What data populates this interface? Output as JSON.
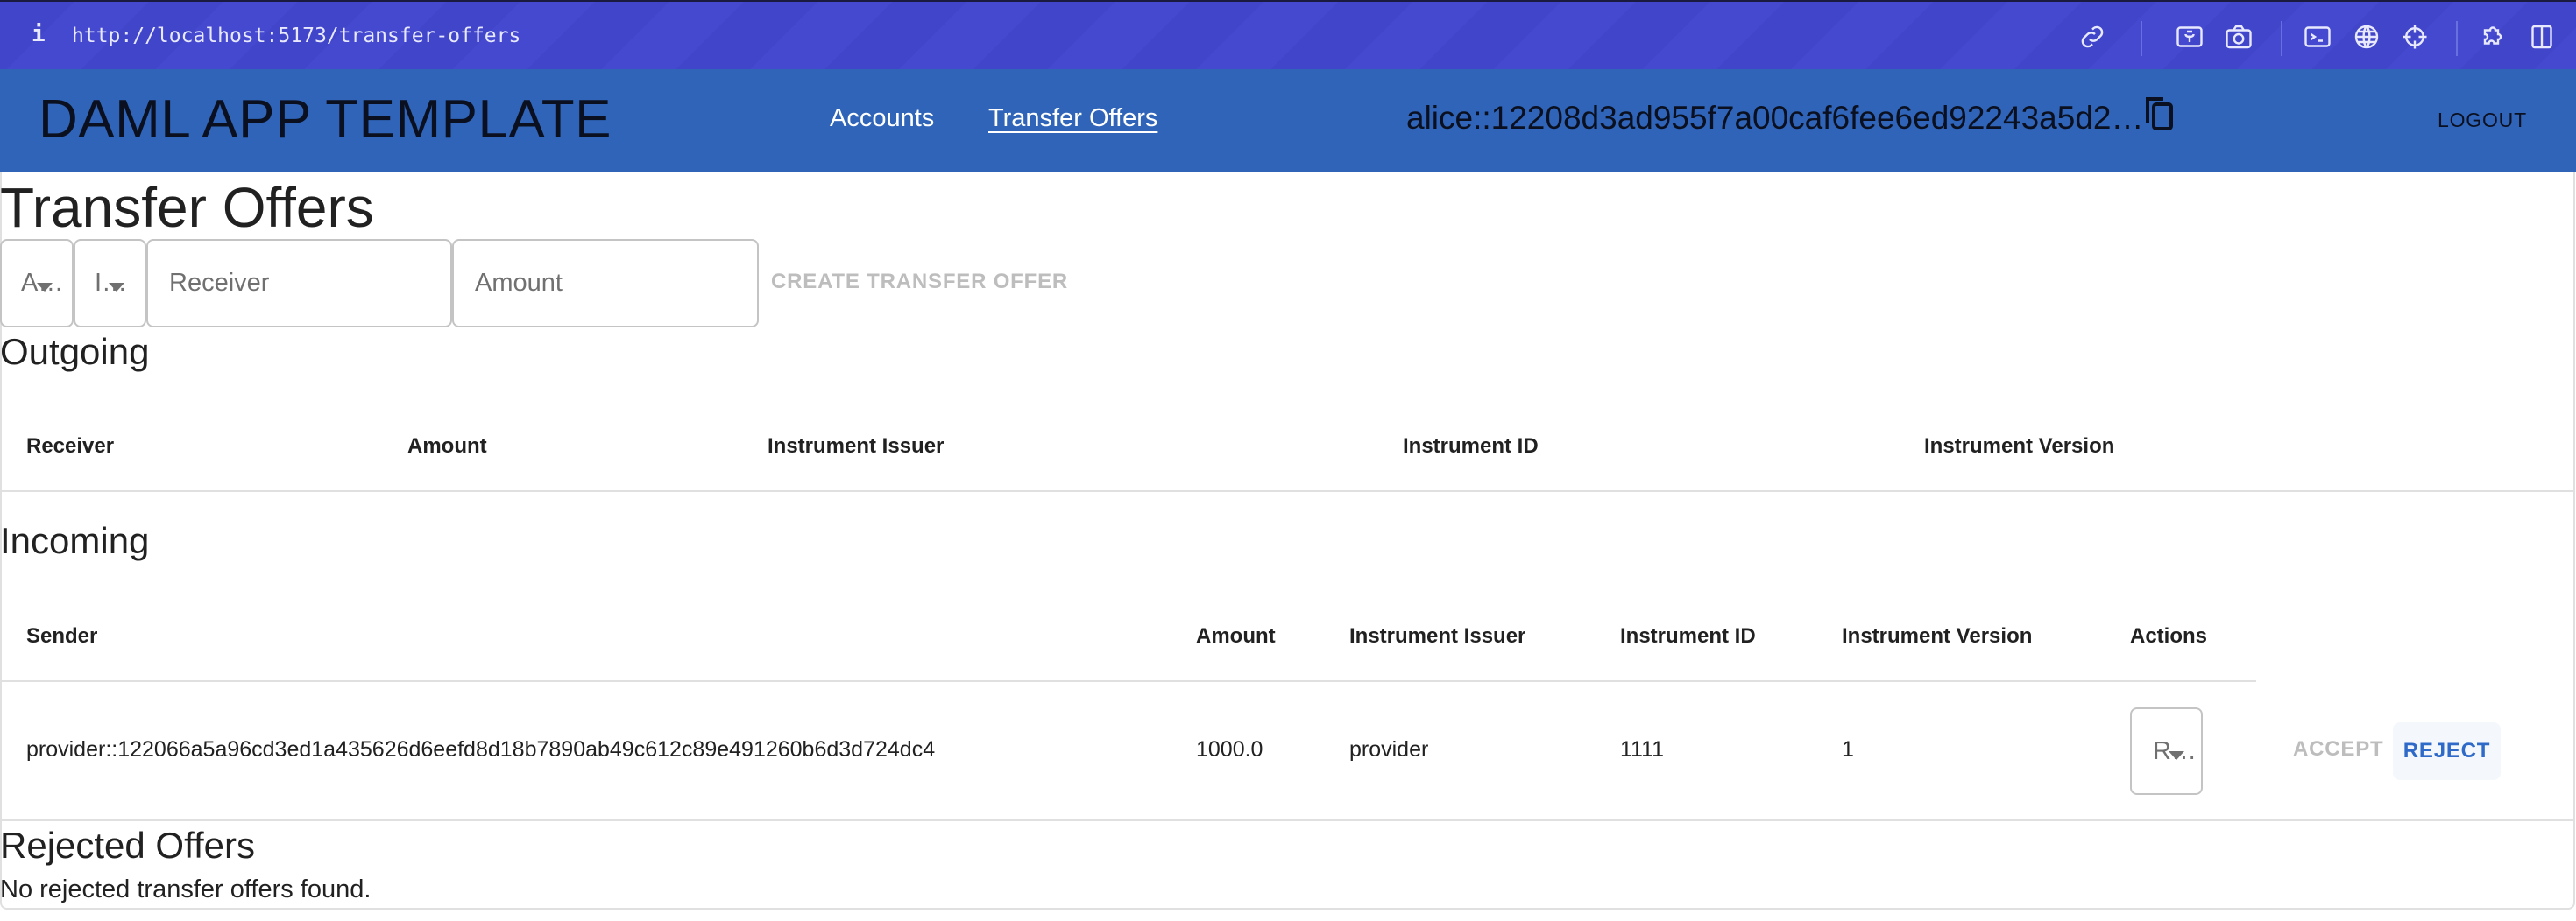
{
  "browser": {
    "url": "http://localhost:5173/transfer-offers",
    "info_glyph": "i",
    "toolbar_icons": [
      "link-icon",
      "image-capture-icon",
      "camera-icon",
      "terminal-icon",
      "globe-icon",
      "crosshair-icon",
      "extensions-icon",
      "sidebar-icon"
    ]
  },
  "header": {
    "app_title": "DAML APP TEMPLATE",
    "nav": [
      {
        "label": "Accounts",
        "active": false
      },
      {
        "label": "Transfer Offers",
        "active": true
      }
    ],
    "party_id": "alice::12208d3ad955f7a00caf6fee6ed92243a5d2…",
    "logout_label": "LOGOUT"
  },
  "page": {
    "title": "Transfer Offers",
    "form": {
      "account_select_value": "A…",
      "instrument_select_value": "I…",
      "receiver_placeholder": "Receiver",
      "amount_placeholder": "Amount",
      "create_label": "CREATE TRANSFER OFFER"
    },
    "outgoing": {
      "title": "Outgoing",
      "columns": [
        "Receiver",
        "Amount",
        "Instrument Issuer",
        "Instrument ID",
        "Instrument Version"
      ],
      "rows": []
    },
    "incoming": {
      "title": "Incoming",
      "columns": [
        "Sender",
        "Amount",
        "Instrument Issuer",
        "Instrument ID",
        "Instrument Version",
        "Actions"
      ],
      "rows": [
        {
          "sender": "provider::122066a5a96cd3ed1a435626d6eefd8d18b7890ab49c612c89e491260b6d3d724dc4",
          "amount": "1000.0",
          "instrument_issuer": "provider",
          "instrument_id": "1111",
          "instrument_version": "1",
          "account_select_value": "R…",
          "accept_label": "ACCEPT",
          "reject_label": "REJECT"
        }
      ]
    },
    "rejected": {
      "title": "Rejected Offers",
      "empty_message": "No rejected transfer offers found."
    }
  },
  "colors": {
    "browser_bar": "#4045c9",
    "app_header": "#2f64b8",
    "accent": "#2f6ac8",
    "disabled_text": "#bdbdbd"
  }
}
